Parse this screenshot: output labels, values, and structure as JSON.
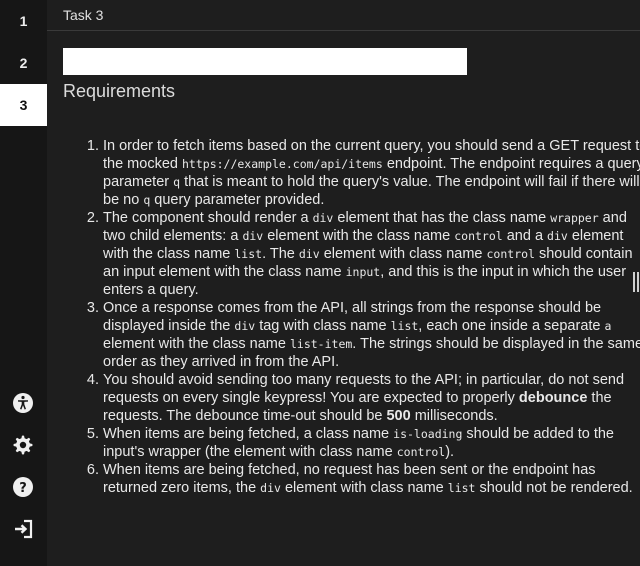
{
  "sidebar": {
    "items": [
      {
        "label": "1",
        "active": false
      },
      {
        "label": "2",
        "active": false
      },
      {
        "label": "3",
        "active": true
      }
    ],
    "icons": [
      "accessibility-icon",
      "gear-icon",
      "help-icon",
      "sign-in-icon"
    ]
  },
  "header": {
    "task_title": "Task 3"
  },
  "main": {
    "input_value": "",
    "heading": "Requirements",
    "requirements": [
      {
        "parts": [
          {
            "t": "In order to fetch items based on the current query, you should send a GET request to the mocked "
          },
          {
            "c": "https://example.com/api/items"
          },
          {
            "t": " endpoint. The endpoint requires a query parameter "
          },
          {
            "c": "q"
          },
          {
            "t": " that is meant to hold the query's value. The endpoint will fail if there will be no "
          },
          {
            "c": "q"
          },
          {
            "t": " query parameter provided."
          }
        ]
      },
      {
        "parts": [
          {
            "t": "The component should render a "
          },
          {
            "c": "div"
          },
          {
            "t": " element that has the class name "
          },
          {
            "c": "wrapper"
          },
          {
            "t": " and two child elements: a "
          },
          {
            "c": "div"
          },
          {
            "t": " element with the class name "
          },
          {
            "c": "control"
          },
          {
            "t": " and a "
          },
          {
            "c": "div"
          },
          {
            "t": " element with the class name "
          },
          {
            "c": "list"
          },
          {
            "t": ". The "
          },
          {
            "c": "div"
          },
          {
            "t": " element with class name "
          },
          {
            "c": "control"
          },
          {
            "t": " should contain an input element with the class name "
          },
          {
            "c": "input"
          },
          {
            "t": ", and this is the input in which the user enters a query."
          }
        ]
      },
      {
        "parts": [
          {
            "t": "Once a response comes from the API, all strings from the response should be displayed inside the "
          },
          {
            "c": "div"
          },
          {
            "t": " tag with class name "
          },
          {
            "c": "list"
          },
          {
            "t": ", each one inside a separate "
          },
          {
            "c": "a"
          },
          {
            "t": " element with the class name "
          },
          {
            "c": "list-item"
          },
          {
            "t": ". The strings should be displayed in the same order as they arrived in from the API."
          }
        ]
      },
      {
        "parts": [
          {
            "t": "You should avoid sending too many requests to the API; in particular, do not send requests on every single keypress! You are expected to properly "
          },
          {
            "b": "debounce"
          },
          {
            "t": " the requests. The debounce time-out should be "
          },
          {
            "b": "500"
          },
          {
            "t": " milliseconds."
          }
        ]
      },
      {
        "parts": [
          {
            "t": "When items are being fetched, a class name "
          },
          {
            "c": "is-loading"
          },
          {
            "t": " should be added to the input's wrapper (the element with class name "
          },
          {
            "c": "control"
          },
          {
            "t": ")."
          }
        ]
      },
      {
        "parts": [
          {
            "t": "When items are being fetched, no request has been sent or the endpoint has returned zero items, the "
          },
          {
            "c": "div"
          },
          {
            "t": " element with class name "
          },
          {
            "c": "list"
          },
          {
            "t": " should not be rendered."
          }
        ]
      }
    ]
  },
  "colors": {
    "sidebar_bg": "#161616",
    "content_bg": "#1e1e1e",
    "active_tab_bg": "#ffffff"
  }
}
